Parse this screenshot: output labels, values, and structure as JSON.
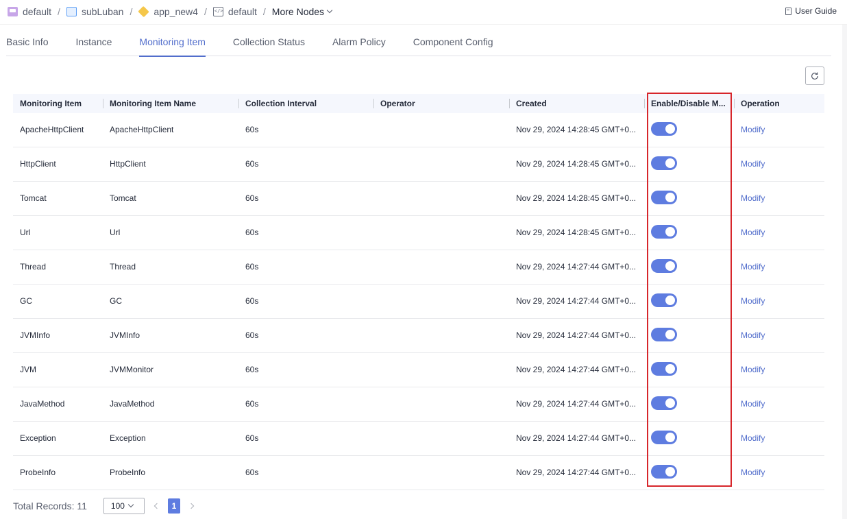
{
  "breadcrumb": {
    "items": [
      {
        "label": "default",
        "icon": "project-icon"
      },
      {
        "label": "subLuban",
        "icon": "folder-icon"
      },
      {
        "label": "app_new4",
        "icon": "app-icon"
      },
      {
        "label": "default",
        "icon": "environment-icon"
      }
    ],
    "more_nodes": "More Nodes"
  },
  "user_guide": "User Guide",
  "tabs": [
    "Basic Info",
    "Instance",
    "Monitoring Item",
    "Collection Status",
    "Alarm Policy",
    "Component Config"
  ],
  "active_tab": "Monitoring Item",
  "table": {
    "headers": [
      "Monitoring Item",
      "Monitoring Item Name",
      "Collection Interval",
      "Operator",
      "Created",
      "Enable/Disable M...",
      "Operation"
    ],
    "rows": [
      {
        "item": "ApacheHttpClient",
        "name": "ApacheHttpClient",
        "interval": "60s",
        "operator": "",
        "created": "Nov 29, 2024 14:28:45 GMT+0...",
        "enabled": true,
        "operation": "Modify"
      },
      {
        "item": "HttpClient",
        "name": "HttpClient",
        "interval": "60s",
        "operator": "",
        "created": "Nov 29, 2024 14:28:45 GMT+0...",
        "enabled": true,
        "operation": "Modify"
      },
      {
        "item": "Tomcat",
        "name": "Tomcat",
        "interval": "60s",
        "operator": "",
        "created": "Nov 29, 2024 14:28:45 GMT+0...",
        "enabled": true,
        "operation": "Modify"
      },
      {
        "item": "Url",
        "name": "Url",
        "interval": "60s",
        "operator": "",
        "created": "Nov 29, 2024 14:28:45 GMT+0...",
        "enabled": true,
        "operation": "Modify"
      },
      {
        "item": "Thread",
        "name": "Thread",
        "interval": "60s",
        "operator": "",
        "created": "Nov 29, 2024 14:27:44 GMT+0...",
        "enabled": true,
        "operation": "Modify"
      },
      {
        "item": "GC",
        "name": "GC",
        "interval": "60s",
        "operator": "",
        "created": "Nov 29, 2024 14:27:44 GMT+0...",
        "enabled": true,
        "operation": "Modify"
      },
      {
        "item": "JVMInfo",
        "name": "JVMInfo",
        "interval": "60s",
        "operator": "",
        "created": "Nov 29, 2024 14:27:44 GMT+0...",
        "enabled": true,
        "operation": "Modify"
      },
      {
        "item": "JVM",
        "name": "JVMMonitor",
        "interval": "60s",
        "operator": "",
        "created": "Nov 29, 2024 14:27:44 GMT+0...",
        "enabled": true,
        "operation": "Modify"
      },
      {
        "item": "JavaMethod",
        "name": "JavaMethod",
        "interval": "60s",
        "operator": "",
        "created": "Nov 29, 2024 14:27:44 GMT+0...",
        "enabled": true,
        "operation": "Modify"
      },
      {
        "item": "Exception",
        "name": "Exception",
        "interval": "60s",
        "operator": "",
        "created": "Nov 29, 2024 14:27:44 GMT+0...",
        "enabled": true,
        "operation": "Modify"
      },
      {
        "item": "ProbeInfo",
        "name": "ProbeInfo",
        "interval": "60s",
        "operator": "",
        "created": "Nov 29, 2024 14:27:44 GMT+0...",
        "enabled": true,
        "operation": "Modify"
      }
    ]
  },
  "footer": {
    "total_records": "Total Records: 11",
    "page_size": "100",
    "current_page": "1"
  },
  "colors": {
    "accent": "#5e7ce0",
    "link": "#526ecc",
    "highlight": "#d7262b"
  }
}
